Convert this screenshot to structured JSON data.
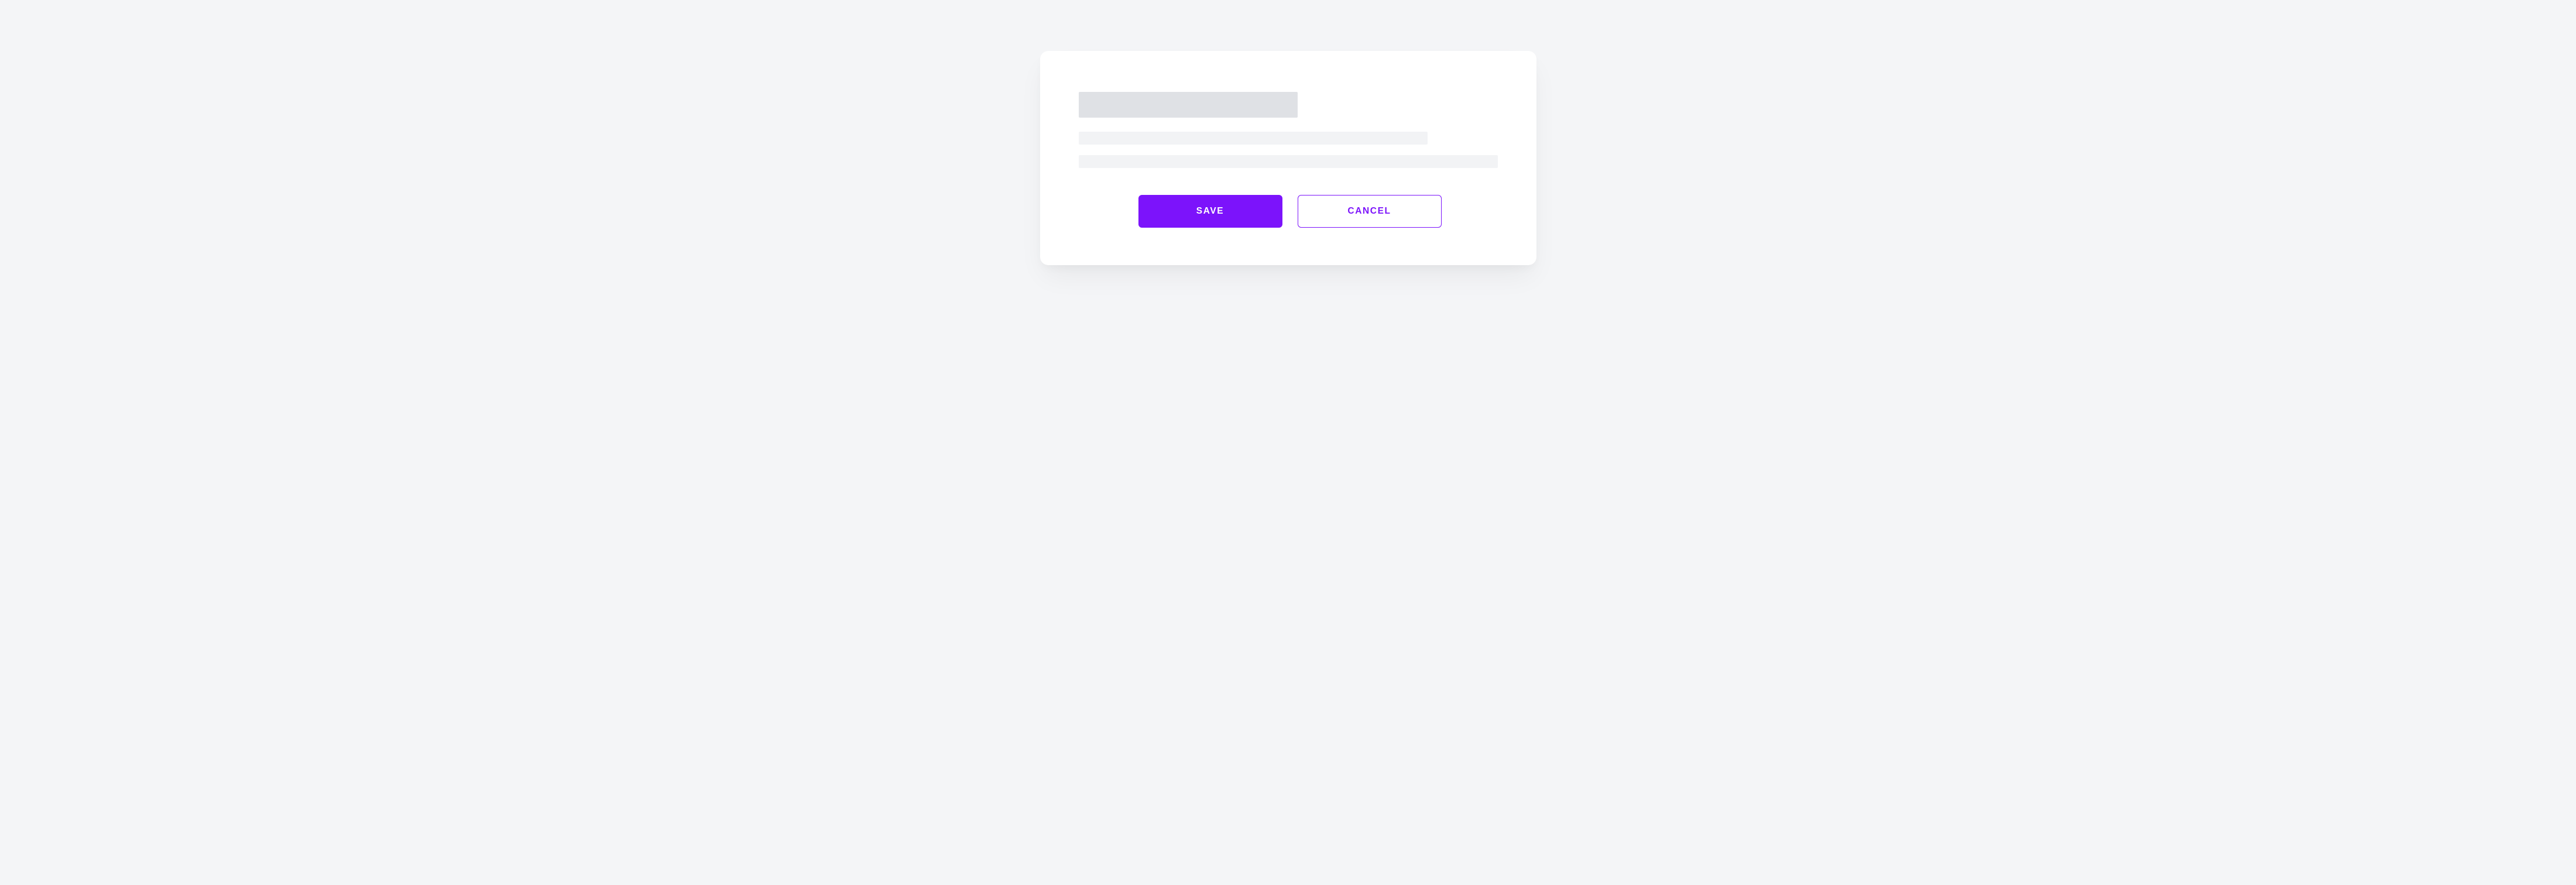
{
  "card": {
    "buttons": {
      "primary_label": "SAVE",
      "secondary_label": "CANCEL"
    },
    "colors": {
      "accent": "#7c13fb"
    }
  }
}
